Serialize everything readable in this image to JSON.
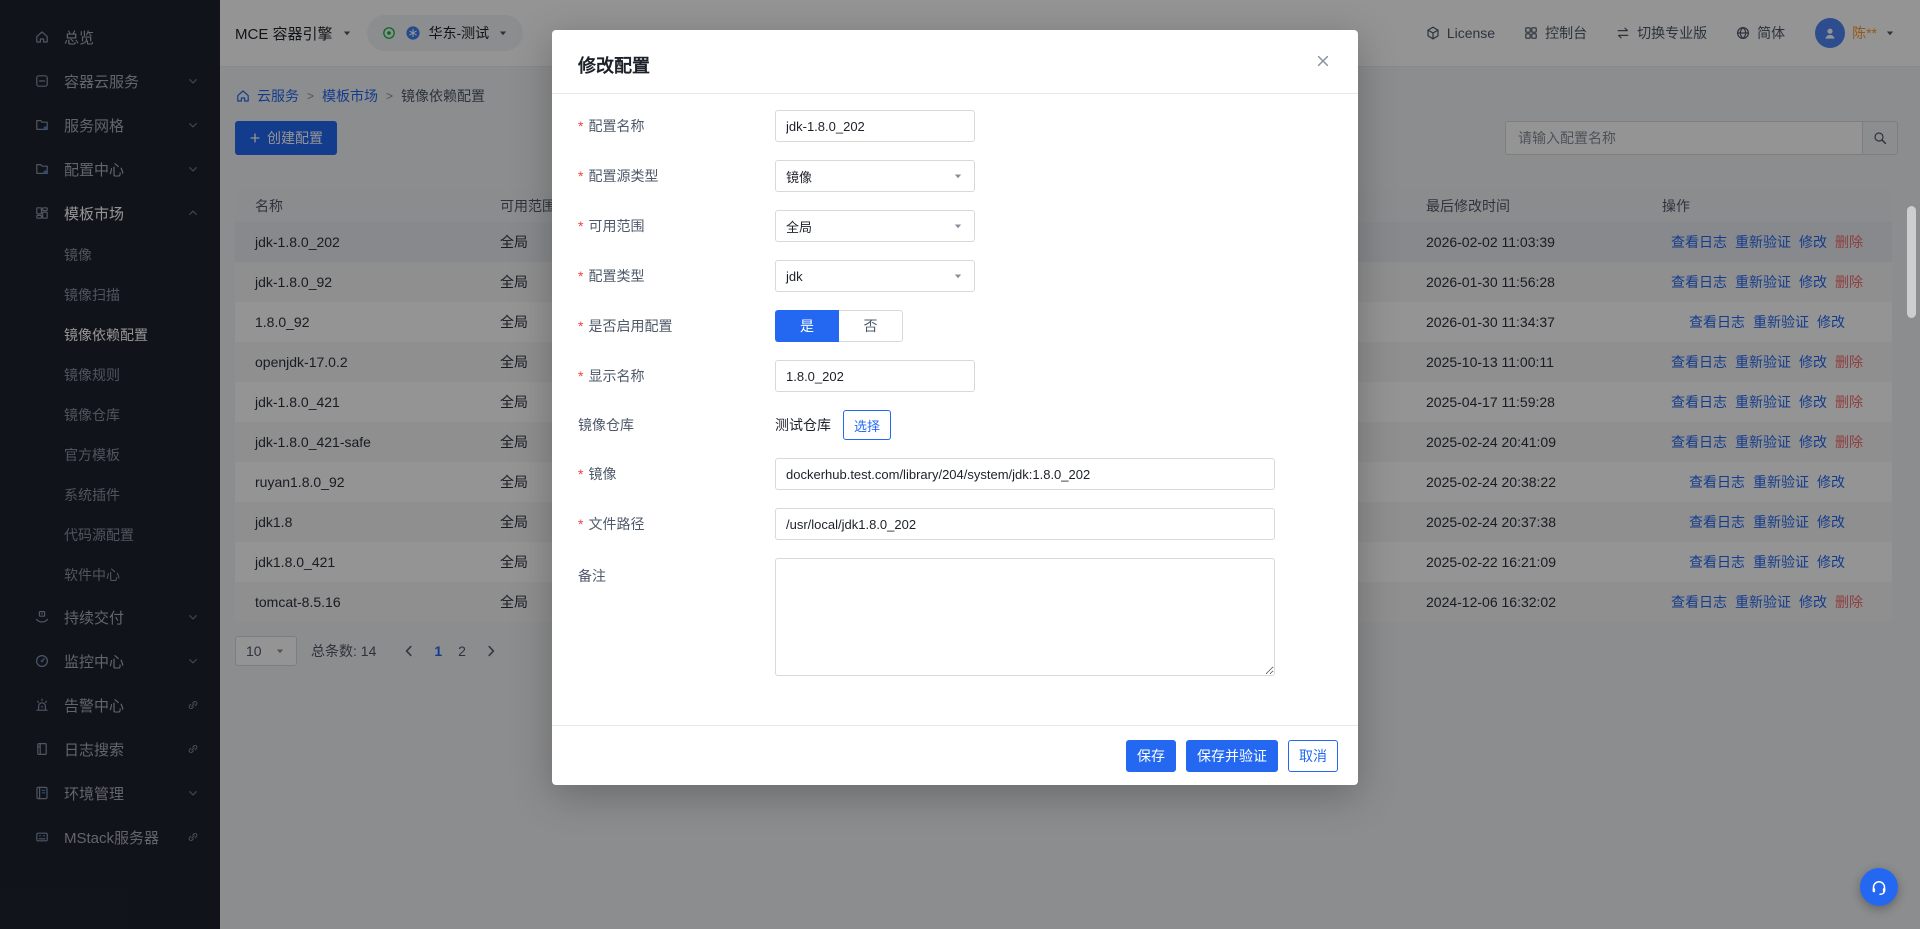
{
  "sidebar": {
    "active_item": "镜像依赖配置",
    "items": [
      {
        "id": "overview",
        "label": "总览",
        "icon": "home"
      },
      {
        "id": "container-cloud",
        "label": "容器云服务",
        "icon": "container",
        "chevron": "down"
      },
      {
        "id": "service-mesh",
        "label": "服务网格",
        "icon": "folder-gear",
        "chevron": "down"
      },
      {
        "id": "config-center",
        "label": "配置中心",
        "icon": "folder-gear",
        "chevron": "down"
      },
      {
        "id": "template-market",
        "label": "模板市场",
        "icon": "template",
        "chevron": "up",
        "expanded": true,
        "children": [
          "镜像",
          "镜像扫描",
          "镜像依赖配置",
          "镜像规则",
          "镜像仓库",
          "官方模板",
          "系统插件",
          "代码源配置",
          "软件中心"
        ]
      },
      {
        "id": "continuous-delivery",
        "label": "持续交付",
        "icon": "delivery",
        "chevron": "down"
      },
      {
        "id": "monitor-center",
        "label": "监控中心",
        "icon": "gauge",
        "chevron": "down"
      },
      {
        "id": "alert-center",
        "label": "告警中心",
        "icon": "siren",
        "link": true
      },
      {
        "id": "log-search",
        "label": "日志搜索",
        "icon": "doc",
        "link": true
      },
      {
        "id": "env-management",
        "label": "环境管理",
        "icon": "book",
        "chevron": "down"
      },
      {
        "id": "mstack-server",
        "label": "MStack服务器",
        "icon": "server",
        "link": true
      }
    ]
  },
  "header": {
    "product": "MCE 容器引擎",
    "region": "华东-测试",
    "license": "License",
    "console": "控制台",
    "switch_pro": "切换专业版",
    "language": "简体",
    "username": "陈**"
  },
  "breadcrumb": {
    "items": [
      "云服务",
      "模板市场",
      "镜像依赖配置"
    ]
  },
  "toolbar": {
    "create_label": "创建配置",
    "search_placeholder": "请输入配置名称"
  },
  "table": {
    "columns": [
      "名称",
      "可用范围",
      "最后修改时间",
      "操作"
    ],
    "danger_action": "删除",
    "rows": [
      {
        "name": "jdk-1.8.0_202",
        "scope": "全局",
        "modified": "2026-02-02 11:03:39",
        "actions": [
          "查看日志",
          "重新验证",
          "修改",
          "删除"
        ],
        "current": true
      },
      {
        "name": "jdk-1.8.0_92",
        "scope": "全局",
        "modified": "2026-01-30 11:56:28",
        "actions": [
          "查看日志",
          "重新验证",
          "修改",
          "删除"
        ]
      },
      {
        "name": "1.8.0_92",
        "scope": "全局",
        "modified": "2026-01-30 11:34:37",
        "actions": [
          "查看日志",
          "重新验证",
          "修改"
        ]
      },
      {
        "name": "openjdk-17.0.2",
        "scope": "全局",
        "modified": "2025-10-13 11:00:11",
        "actions": [
          "查看日志",
          "重新验证",
          "修改",
          "删除"
        ]
      },
      {
        "name": "jdk-1.8.0_421",
        "scope": "全局",
        "modified": "2025-04-17 11:59:28",
        "actions": [
          "查看日志",
          "重新验证",
          "修改",
          "删除"
        ]
      },
      {
        "name": "jdk-1.8.0_421-safe",
        "scope": "全局",
        "modified": "2025-02-24 20:41:09",
        "actions": [
          "查看日志",
          "重新验证",
          "修改",
          "删除"
        ]
      },
      {
        "name": "ruyan1.8.0_92",
        "scope": "全局",
        "modified": "2025-02-24 20:38:22",
        "actions": [
          "查看日志",
          "重新验证",
          "修改"
        ]
      },
      {
        "name": "jdk1.8",
        "scope": "全局",
        "modified": "2025-02-24 20:37:38",
        "actions": [
          "查看日志",
          "重新验证",
          "修改"
        ]
      },
      {
        "name": "jdk1.8.0_421",
        "scope": "全局",
        "modified": "2025-02-22 16:21:09",
        "actions": [
          "查看日志",
          "重新验证",
          "修改"
        ]
      },
      {
        "name": "tomcat-8.5.16",
        "scope": "全局",
        "modified": "2024-12-06 16:32:02",
        "actions": [
          "查看日志",
          "重新验证",
          "修改",
          "删除"
        ]
      }
    ]
  },
  "pagination": {
    "page_size": "10",
    "total_label": "总条数: 14",
    "pages": [
      "1",
      "2"
    ],
    "active_page": "1"
  },
  "modal": {
    "title": "修改配置",
    "fields": {
      "config_name": {
        "label": "配置名称",
        "value": "jdk-1.8.0_202"
      },
      "source_type": {
        "label": "配置源类型",
        "value": "镜像"
      },
      "scope": {
        "label": "可用范围",
        "value": "全局"
      },
      "config_type": {
        "label": "配置类型",
        "value": "jdk"
      },
      "enabled": {
        "label": "是否启用配置",
        "yes": "是",
        "no": "否",
        "value": "是"
      },
      "display_name": {
        "label": "显示名称",
        "value": "1.8.0_202"
      },
      "image_repo": {
        "label": "镜像仓库",
        "value": "测试仓库",
        "select_label": "选择"
      },
      "image": {
        "label": "镜像",
        "value": "dockerhub.test.com/library/204/system/jdk:1.8.0_202"
      },
      "file_path": {
        "label": "文件路径",
        "value": "/usr/local/jdk1.8.0_202"
      },
      "remark": {
        "label": "备注",
        "value": ""
      }
    },
    "footer": {
      "save": "保存",
      "save_verify": "保存并验证",
      "cancel": "取消"
    }
  },
  "colors": {
    "primary": "#2468f2",
    "danger": "#f56c6c",
    "username_accent": "#ff9a2e",
    "region_pin_green": "#00b42a"
  }
}
